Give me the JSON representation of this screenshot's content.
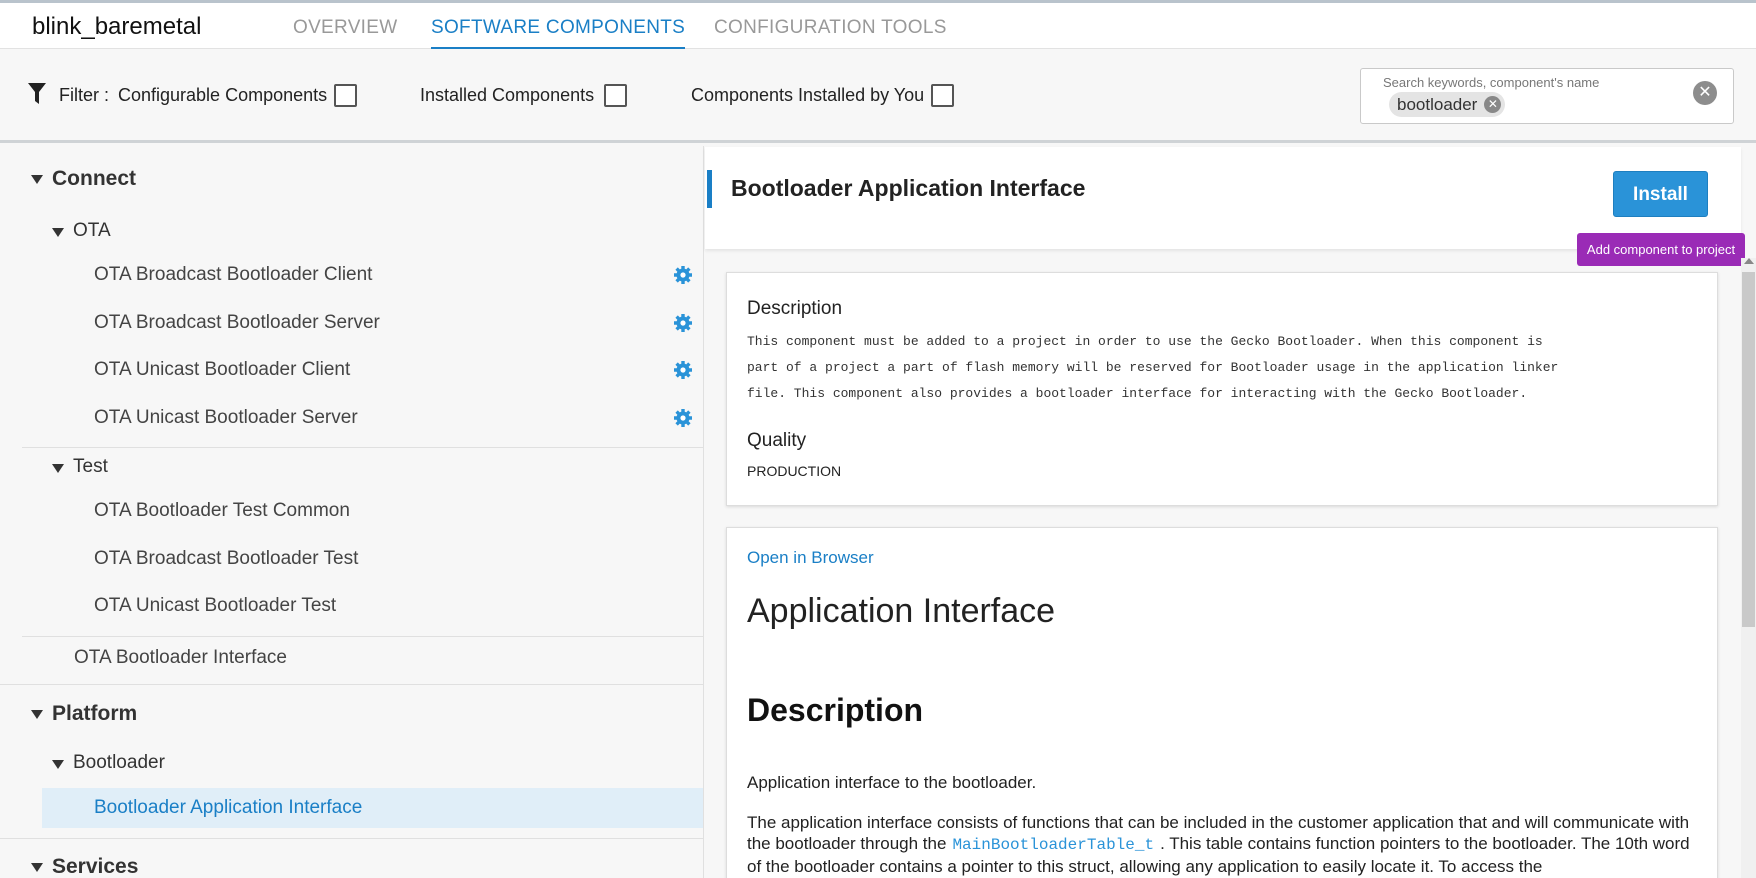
{
  "app": {
    "title": "blink_baremetal",
    "tabs": [
      {
        "label": "OVERVIEW",
        "active": false
      },
      {
        "label": "SOFTWARE COMPONENTS",
        "active": true
      },
      {
        "label": "CONFIGURATION TOOLS",
        "active": false
      }
    ]
  },
  "filter": {
    "label": "Filter :",
    "options": [
      {
        "label": "Configurable Components",
        "checked": false
      },
      {
        "label": "Installed Components",
        "checked": false
      },
      {
        "label": "Components Installed by You",
        "checked": false
      }
    ]
  },
  "search": {
    "placeholder": "Search keywords, component's name",
    "chip": "bootloader"
  },
  "tree": {
    "categories": [
      {
        "label": "Connect",
        "groups": [
          {
            "label": "OTA",
            "items": [
              {
                "label": "OTA Broadcast Bootloader Client",
                "configurable": true
              },
              {
                "label": "OTA Broadcast Bootloader Server",
                "configurable": true
              },
              {
                "label": "OTA Unicast Bootloader Client",
                "configurable": true
              },
              {
                "label": "OTA Unicast Bootloader Server",
                "configurable": true
              }
            ]
          },
          {
            "label": "Test",
            "items": [
              {
                "label": "OTA Bootloader Test Common"
              },
              {
                "label": "OTA Broadcast Bootloader Test"
              },
              {
                "label": "OTA Unicast Bootloader Test"
              }
            ]
          }
        ],
        "leaf": "OTA Bootloader Interface"
      },
      {
        "label": "Platform",
        "groups": [
          {
            "label": "Bootloader",
            "items": [
              {
                "label": "Bootloader Application Interface",
                "selected": true
              }
            ]
          }
        ]
      },
      {
        "label": "Services"
      }
    ]
  },
  "detail": {
    "title": "Bootloader Application Interface",
    "install_label": "Install",
    "tooltip": "Add component to project",
    "description_heading": "Description",
    "description_lines": [
      "This component must be added to a project in order to use the Gecko Bootloader. When this component is",
      "part of a project a part of flash memory will be reserved for Bootloader usage in the application linker",
      "file. This component also provides a bootloader interface for interacting with the Gecko Bootloader."
    ],
    "quality_heading": "Quality",
    "quality_value": "PRODUCTION",
    "doc": {
      "open_link": "Open in Browser",
      "heading": "Application Interface",
      "section_heading": "Description",
      "intro": "Application interface to the bootloader.",
      "para_part1": "The application interface consists of functions that can be included in the customer application that and will communicate with the bootloader through the",
      "para_code": "MainBootloaderTable_t",
      "para_part2": ". This table contains function pointers to the bootloader. The 10th word of the bootloader contains a pointer to this struct, allowing any application to easily locate it. To access the"
    }
  },
  "colors": {
    "accent": "#1a7fc6",
    "install_button": "#2a93d8",
    "tooltip": "#9a2bb6",
    "selected_bg": "#e0eef8"
  }
}
